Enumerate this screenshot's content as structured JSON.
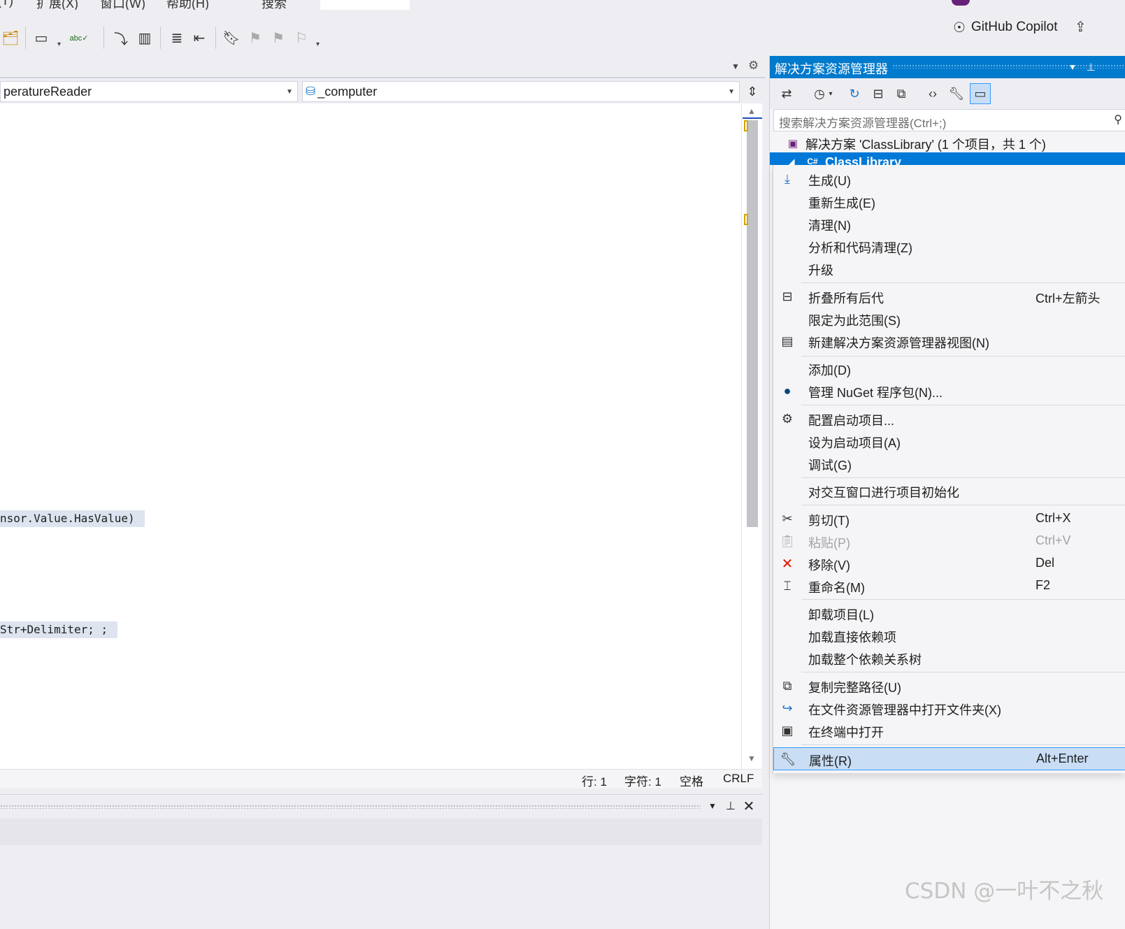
{
  "menu": {
    "partial_items": [
      "(T)",
      "扩展(X)",
      "窗口(W)",
      "帮助(H)",
      "搜索"
    ],
    "active_tab": "ClassLibrary"
  },
  "copilot": {
    "label": "GitHub Copilot",
    "icon": "copilot-icon"
  },
  "editor": {
    "type_combo": "peratureReader",
    "member_combo": "_computer",
    "code_lines": [
      {
        "text": "nsor.Value.HasValue)"
      },
      {
        "text": "Str+Delimiter; ;"
      }
    ]
  },
  "status": {
    "line": "行: 1",
    "col": "字符: 1",
    "indent": "空格",
    "eol": "CRLF"
  },
  "solution_explorer": {
    "title": "解决方案资源管理器",
    "search_placeholder": "搜索解决方案资源管理器(Ctrl+;)",
    "solution_node": "解决方案 'ClassLibrary' (1 个项目，共 1 个)",
    "project_node": "ClassLibrary"
  },
  "context_menu": [
    {
      "label": "生成(U)",
      "shortcut": "",
      "icon": "build-icon"
    },
    {
      "label": "重新生成(E)",
      "shortcut": ""
    },
    {
      "label": "清理(N)",
      "shortcut": ""
    },
    {
      "label": "分析和代码清理(Z)",
      "shortcut": ""
    },
    {
      "label": "升级",
      "shortcut": ""
    },
    {
      "label": "折叠所有后代",
      "shortcut": "Ctrl+左箭头",
      "icon": "collapse-icon"
    },
    {
      "label": "限定为此范围(S)",
      "shortcut": ""
    },
    {
      "label": "新建解决方案资源管理器视图(N)",
      "shortcut": "",
      "icon": "new-view-icon"
    },
    {
      "label": "添加(D)",
      "shortcut": ""
    },
    {
      "label": "管理 NuGet 程序包(N)...",
      "shortcut": "",
      "icon": "nuget-icon"
    },
    {
      "label": "配置启动项目...",
      "shortcut": "",
      "icon": "gear-icon"
    },
    {
      "label": "设为启动项目(A)",
      "shortcut": ""
    },
    {
      "label": "调试(G)",
      "shortcut": ""
    },
    {
      "label": "对交互窗口进行项目初始化",
      "shortcut": ""
    },
    {
      "label": "剪切(T)",
      "shortcut": "Ctrl+X",
      "icon": "scissors-icon"
    },
    {
      "label": "粘贴(P)",
      "shortcut": "Ctrl+V",
      "icon": "paste-icon",
      "disabled": true
    },
    {
      "label": "移除(V)",
      "shortcut": "Del",
      "icon": "remove-icon"
    },
    {
      "label": "重命名(M)",
      "shortcut": "F2",
      "icon": "rename-icon"
    },
    {
      "label": "卸载项目(L)",
      "shortcut": ""
    },
    {
      "label": "加载直接依赖项",
      "shortcut": ""
    },
    {
      "label": "加载整个依赖关系树",
      "shortcut": ""
    },
    {
      "label": "复制完整路径(U)",
      "shortcut": "",
      "icon": "copy-icon"
    },
    {
      "label": "在文件资源管理器中打开文件夹(X)",
      "shortcut": "",
      "icon": "open-folder-icon"
    },
    {
      "label": "在终端中打开",
      "shortcut": "",
      "icon": "terminal-icon"
    },
    {
      "label": "属性(R)",
      "shortcut": "Alt+Enter",
      "icon": "wrench-icon",
      "highlighted": true
    }
  ],
  "watermark": "CSDN @一叶不之秋",
  "colors": {
    "accent": "#007acc",
    "selection": "#0078d7",
    "highlight": "#c9def5"
  }
}
